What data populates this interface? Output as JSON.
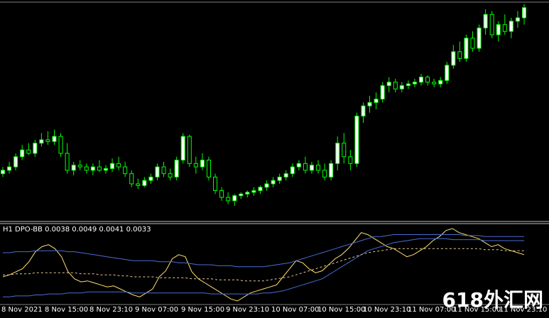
{
  "indicator": {
    "label": "H1 DPO-BB 0.0038 0.0049 0.0041 0.0033"
  },
  "x_ticks": [
    "8 Nov 2021",
    "8 Nov 15:00",
    "8 Nov 23:10",
    "9 Nov 07:00",
    "9 Nov 15:00",
    "9 Nov 23:10",
    "10 Nov 07:00",
    "10 Nov 15:00",
    "10 Nov 23:10",
    "11 Nov 07:00",
    "11 Nov 15:00",
    "11 Nov 23:10"
  ],
  "watermark": "618外汇网",
  "colors": {
    "background": "#000000",
    "bull_candle": "#ffffff",
    "wick": "#00ff00",
    "dpo_line": "#ffe070",
    "band_line": "#4a6cd4",
    "middle_line": "#e8c890",
    "separator": "#c0c0c0"
  },
  "chart_data": [
    {
      "type": "candlestick",
      "title": "",
      "ylim": [
        0,
        100
      ],
      "candles": [
        [
          38,
          42,
          36,
          40
        ],
        [
          40,
          45,
          38,
          42
        ],
        [
          42,
          50,
          40,
          48
        ],
        [
          48,
          55,
          46,
          52
        ],
        [
          52,
          56,
          49,
          50
        ],
        [
          50,
          58,
          48,
          56
        ],
        [
          56,
          62,
          54,
          58
        ],
        [
          58,
          63,
          55,
          57
        ],
        [
          57,
          64,
          55,
          60
        ],
        [
          60,
          62,
          48,
          50
        ],
        [
          50,
          56,
          38,
          40
        ],
        [
          40,
          45,
          37,
          43
        ],
        [
          43,
          46,
          40,
          42
        ],
        [
          42,
          44,
          38,
          40
        ],
        [
          40,
          44,
          37,
          42
        ],
        [
          42,
          46,
          39,
          40
        ],
        [
          40,
          43,
          38,
          41
        ],
        [
          41,
          47,
          39,
          44
        ],
        [
          44,
          48,
          40,
          42
        ],
        [
          42,
          45,
          36,
          38
        ],
        [
          38,
          40,
          30,
          32
        ],
        [
          32,
          35,
          29,
          31
        ],
        [
          31,
          36,
          30,
          34
        ],
        [
          34,
          38,
          32,
          36
        ],
        [
          36,
          44,
          34,
          42
        ],
        [
          42,
          45,
          36,
          38
        ],
        [
          38,
          41,
          34,
          36
        ],
        [
          36,
          48,
          34,
          46
        ],
        [
          46,
          62,
          44,
          60
        ],
        [
          60,
          61,
          42,
          44
        ],
        [
          44,
          48,
          38,
          42
        ],
        [
          42,
          50,
          40,
          46
        ],
        [
          46,
          48,
          34,
          36
        ],
        [
          36,
          38,
          26,
          28
        ],
        [
          28,
          30,
          22,
          24
        ],
        [
          24,
          27,
          20,
          22
        ],
        [
          22,
          26,
          19,
          25
        ],
        [
          25,
          27,
          23,
          26
        ],
        [
          26,
          28,
          24,
          27
        ],
        [
          27,
          30,
          25,
          28
        ],
        [
          28,
          31,
          26,
          30
        ],
        [
          30,
          34,
          28,
          32
        ],
        [
          32,
          36,
          30,
          34
        ],
        [
          34,
          38,
          32,
          36
        ],
        [
          36,
          40,
          34,
          38
        ],
        [
          38,
          44,
          36,
          42
        ],
        [
          42,
          46,
          40,
          44
        ],
        [
          44,
          48,
          38,
          40
        ],
        [
          40,
          45,
          38,
          43
        ],
        [
          43,
          46,
          38,
          40
        ],
        [
          40,
          44,
          34,
          36
        ],
        [
          36,
          46,
          34,
          44
        ],
        [
          44,
          60,
          40,
          56
        ],
        [
          56,
          62,
          44,
          48
        ],
        [
          48,
          52,
          40,
          44
        ],
        [
          44,
          74,
          42,
          72
        ],
        [
          72,
          80,
          68,
          78
        ],
        [
          78,
          84,
          74,
          80
        ],
        [
          80,
          86,
          76,
          82
        ],
        [
          82,
          92,
          80,
          90
        ],
        [
          90,
          95,
          86,
          92
        ],
        [
          92,
          94,
          86,
          88
        ],
        [
          88,
          92,
          86,
          90
        ],
        [
          90,
          93,
          88,
          91
        ],
        [
          91,
          94,
          89,
          92
        ],
        [
          92,
          97,
          90,
          95
        ],
        [
          95,
          96,
          90,
          92
        ],
        [
          92,
          94,
          89,
          91
        ],
        [
          91,
          95,
          89,
          93
        ],
        [
          93,
          104,
          91,
          102
        ],
        [
          102,
          114,
          100,
          110
        ],
        [
          110,
          116,
          104,
          106
        ],
        [
          106,
          120,
          104,
          118
        ],
        [
          118,
          122,
          110,
          112
        ],
        [
          112,
          126,
          110,
          124
        ],
        [
          124,
          135,
          120,
          132
        ],
        [
          132,
          134,
          118,
          120
        ],
        [
          120,
          128,
          116,
          126
        ],
        [
          126,
          132,
          120,
          122
        ],
        [
          122,
          130,
          118,
          128
        ],
        [
          128,
          134,
          124,
          130
        ],
        [
          130,
          138,
          126,
          136
        ]
      ]
    },
    {
      "type": "line",
      "title": "",
      "series": [
        {
          "values": [
            -10,
            -8,
            -5,
            -2,
            5,
            15,
            20,
            22,
            18,
            10,
            -5,
            -12,
            -15,
            -14,
            -16,
            -18,
            -20,
            -19,
            -22,
            -25,
            -28,
            -30,
            -26,
            -22,
            -10,
            -4,
            8,
            12,
            10,
            -5,
            -12,
            -16,
            -20,
            -24,
            -28,
            -32,
            -34,
            -30,
            -26,
            -24,
            -22,
            -20,
            -18,
            -10,
            -2,
            6,
            4,
            -2,
            -6,
            -4,
            2,
            8,
            12,
            18,
            26,
            34,
            32,
            28,
            24,
            20,
            18,
            14,
            10,
            12,
            16,
            20,
            26,
            30,
            36,
            38,
            34,
            32,
            30,
            28,
            24,
            20,
            22,
            18,
            16,
            14,
            12
          ]
        },
        {
          "values": [
            -30,
            -30,
            -29,
            -29,
            -29,
            -28,
            -28,
            -27,
            -27,
            -27,
            -26,
            -26,
            -26,
            -25,
            -25,
            -25,
            -25,
            -25,
            -25,
            -25,
            -26,
            -26,
            -26,
            -26,
            -26,
            -26,
            -26,
            -26,
            -26,
            -26,
            -26,
            -26,
            -27,
            -27,
            -27,
            -27,
            -27,
            -27,
            -27,
            -27,
            -26,
            -26,
            -25,
            -24,
            -22,
            -20,
            -18,
            -16,
            -14,
            -12,
            -8,
            -4,
            0,
            4,
            8,
            12,
            16,
            18,
            20,
            22,
            24,
            25,
            26,
            27,
            28,
            28,
            28,
            28,
            28,
            27,
            27,
            27,
            27,
            27,
            26,
            26,
            26,
            26,
            26,
            26,
            26
          ]
        },
        {
          "values": [
            -8,
            -8,
            -7,
            -7,
            -7,
            -6,
            -6,
            -6,
            -6,
            -6,
            -6,
            -6,
            -7,
            -7,
            -7,
            -8,
            -8,
            -8,
            -9,
            -9,
            -10,
            -10,
            -10,
            -10,
            -11,
            -11,
            -11,
            -11,
            -11,
            -12,
            -12,
            -12,
            -12,
            -13,
            -13,
            -13,
            -13,
            -14,
            -14,
            -14,
            -14,
            -13,
            -12,
            -11,
            -10,
            -8,
            -6,
            -4,
            -2,
            0,
            2,
            4,
            6,
            8,
            10,
            12,
            14,
            15,
            16,
            17,
            18,
            18,
            18,
            18,
            18,
            18,
            18,
            18,
            18,
            18,
            18,
            18,
            18,
            18,
            17,
            17,
            17,
            16,
            16,
            16,
            16
          ]
        },
        {
          "values": [
            14,
            14,
            15,
            15,
            15,
            16,
            16,
            16,
            16,
            16,
            15,
            15,
            14,
            13,
            12,
            11,
            10,
            9,
            8,
            7,
            6,
            6,
            6,
            6,
            5,
            5,
            5,
            4,
            4,
            3,
            2,
            2,
            2,
            1,
            1,
            1,
            0,
            0,
            0,
            0,
            0,
            1,
            2,
            3,
            4,
            6,
            8,
            10,
            12,
            14,
            16,
            18,
            20,
            22,
            24,
            26,
            28,
            30,
            30,
            31,
            32,
            32,
            32,
            32,
            32,
            32,
            32,
            32,
            32,
            32,
            32,
            31,
            31,
            31,
            30,
            30,
            30,
            30,
            30,
            30,
            30
          ]
        }
      ]
    }
  ]
}
